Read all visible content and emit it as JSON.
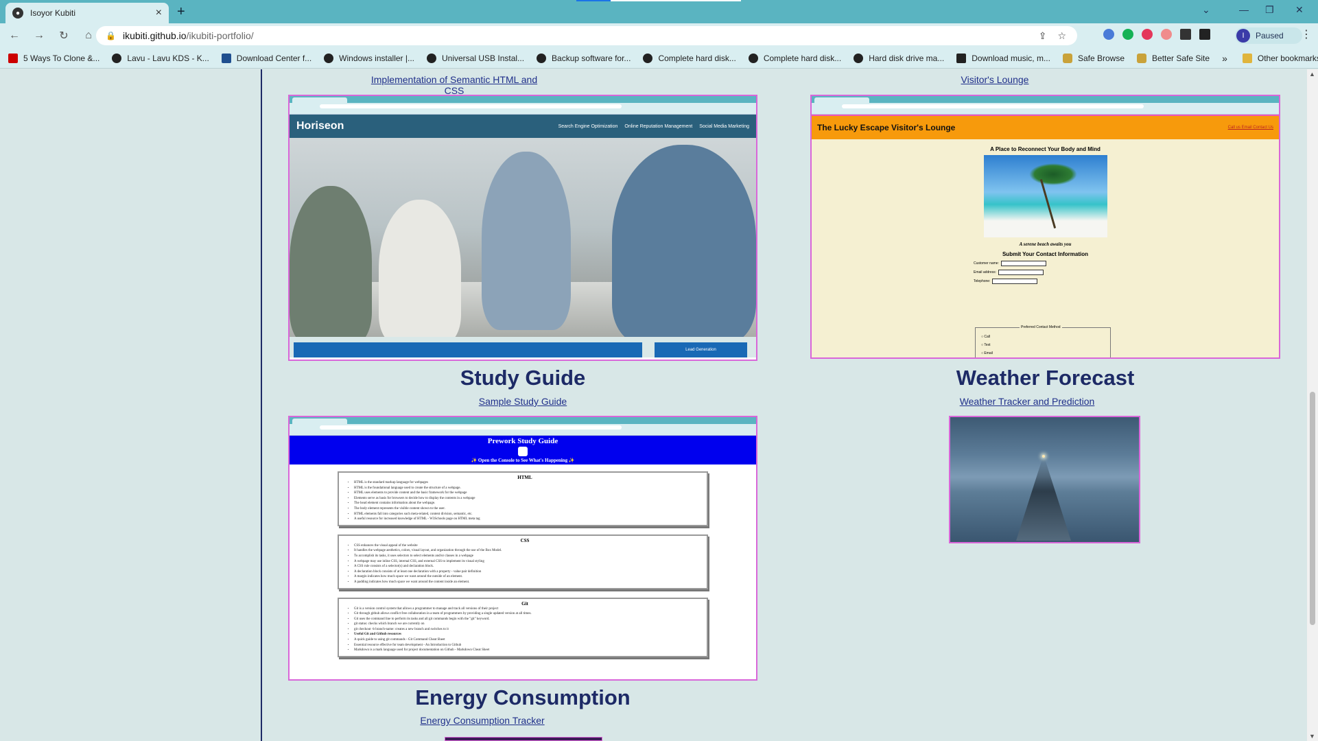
{
  "browser": {
    "tab_title": "Isoyor Kubiti",
    "url_host": "ikubiti.github.io",
    "url_path": "/ikubiti-portfolio/",
    "profile_label": "Paused",
    "profile_initial": "I",
    "bookmarks": [
      "5 Ways To Clone &...",
      "Lavu - Lavu KDS - K...",
      "Download Center f...",
      "Windows installer |...",
      "Universal USB Instal...",
      "Backup software for...",
      "Complete hard disk...",
      "Complete hard disk...",
      "Hard disk drive ma...",
      "Download music, m...",
      "Safe Browse",
      "Better Safe Site"
    ],
    "other_bookmarks": "Other bookmarks",
    "more_bookmarks": "»"
  },
  "projects": {
    "top_left_link": "Implementation of Semantic HTML and CSS",
    "top_right_link": "Visitor's Lounge",
    "study_guide": {
      "title": "Study Guide",
      "link": "Sample Study Guide"
    },
    "weather": {
      "title": "Weather Forecast",
      "link": "Weather Tracker and Prediction"
    },
    "energy": {
      "title": "Energy Consumption",
      "link": "Energy Consumption Tracker"
    }
  },
  "horiseon_preview": {
    "brand": "Horiseon",
    "nav": [
      "Search Engine Optimization",
      "Online Reputation Management",
      "Social Media Marketing"
    ],
    "cta": "Lead Generation"
  },
  "lucky_preview": {
    "title": "The Lucky Escape Visitor's Lounge",
    "header_links": "Call us  Email  Contact Us",
    "subtitle": "A Place to Reconnect Your Body and Mind",
    "caption": "A serene beach awaits you",
    "form_title": "Submit Your Contact Information",
    "fields": [
      "Customer name:",
      "Email address:",
      "Telephone:"
    ],
    "legend": "Preferred Contact Method",
    "options": [
      "Call",
      "Text",
      "Email"
    ]
  },
  "study_preview": {
    "title": "Prework Study Guide",
    "subtitle": "✨ Open the Console to See What's Happening ✨",
    "sections": [
      {
        "heading": "HTML",
        "items": [
          "HTML is the standard markup language for webpages",
          "HTML is the foundational language used to create the structure of a webpage.",
          "HTML uses elements to provide content and the basic framework for the webpage",
          "Elements serve as basis for browsers to decide how to display the contents in a webpage",
          "The head element contains information about the webpage.",
          "The body element represents the visible content shown to the user.",
          "HTML elements fall into categories such meta-related, content division, semantic, etc.",
          "A useful resource for increased knowledge of HTML - W3Schools page on HTML meta tag"
        ]
      },
      {
        "heading": "CSS",
        "items": [
          "CSS enhances the visual appeal of the website",
          "It handles the webpage aesthetics, colors, visual layout, and organization through the use of the Box Model.",
          "To accomplish its tasks, it uses selectors to select elements and/or classes in a webpage",
          "A webpage may use inline CSS, internal CSS, and external CSS to implement its visual styling",
          "A CSS rule consists of a selector(s) and declaration block.",
          "A declaration block consists of at least one declaration with a property - value pair definition",
          "A margin indicates how much space we want around the outside of an element.",
          "A padding indicates how much space we want around the content inside an element."
        ]
      },
      {
        "heading": "Git",
        "items": [
          "Git is a version control system that allows a programmer to manage and track all versions of their project",
          "Git through github allows conflict free collaboration in a team of programmers by providing a single updated version at all times.",
          "Git uses the command line to perform its tasks and all git commands begin with the \"git\" keyword.",
          "git status: checks which branch we are currently on",
          "git checkout -b branch-name: creates a new branch and switches to it",
          "Useful Git and Github resources",
          "A quick guide to using git commands - Git Command Cheat Sheet",
          "Essential resource effective for team development - An Introduction to Github",
          "Markdown is a mark language used for project documentation on Github - Markdown Cheat Sheet"
        ]
      }
    ]
  },
  "colors": {
    "accent": "#1d2a66",
    "thumb_border": "#d966d9",
    "page_bg": "#d8e7e7",
    "browser_teal": "#5ab4c1"
  }
}
